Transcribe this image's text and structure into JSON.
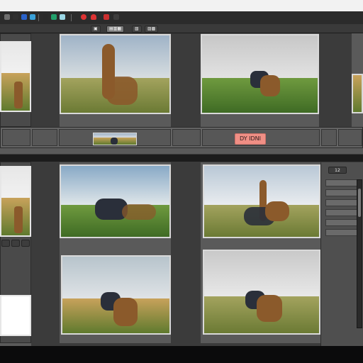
{
  "toolbar": {
    "icons": [
      {
        "name": "folder-icon",
        "color": "#6e6e6e"
      },
      {
        "name": "save-icon",
        "color": "#2f2f2f"
      },
      {
        "name": "grid-icon",
        "color": "#2a62c9"
      },
      {
        "name": "crop-icon",
        "color": "#39a0d8"
      },
      {
        "name": "camera-icon",
        "color": "#2a2a2a"
      },
      {
        "name": "film-icon",
        "color": "#21a06b"
      },
      {
        "name": "settings-icon",
        "color": "#9ad6e4"
      },
      {
        "name": "record-icon",
        "color": "#d33"
      },
      {
        "name": "heart-icon",
        "color": "#d33"
      }
    ]
  },
  "tabs": [
    {
      "label": "▣",
      "active": false
    },
    {
      "label": "▤▥▦",
      "active": true
    },
    {
      "label": "▧",
      "active": false
    },
    {
      "label": "▨▩",
      "active": false
    }
  ],
  "strip_top": {
    "badge_text": "DY  IDNI"
  },
  "dock": {
    "items_count": "12"
  },
  "colors": {
    "accent_badge": "#f08f85",
    "panel_bg": "#4a4a4a",
    "app_bg": "#5a5a5a"
  }
}
